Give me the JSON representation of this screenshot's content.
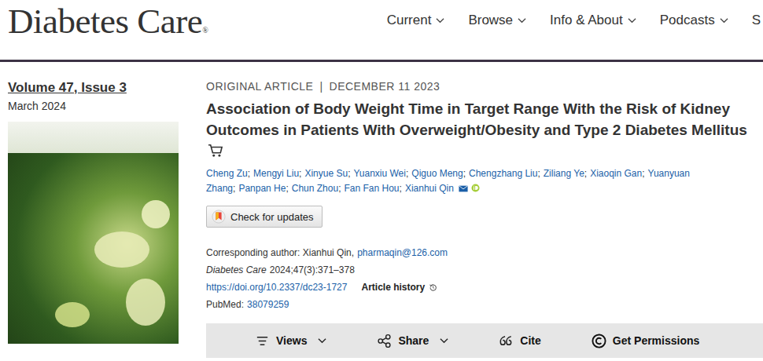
{
  "logo": {
    "text": "Diabetes Care",
    "mark": "®"
  },
  "nav": [
    {
      "label": "Current",
      "has_menu": true
    },
    {
      "label": "Browse",
      "has_menu": true
    },
    {
      "label": "Info & About",
      "has_menu": true
    },
    {
      "label": "Podcasts",
      "has_menu": true
    },
    {
      "label": "S",
      "has_menu": false
    }
  ],
  "issue": {
    "volume": "Volume 47, Issue 3",
    "date": "March 2024"
  },
  "article": {
    "type": "ORIGINAL ARTICLE",
    "separator": "|",
    "date": "DECEMBER 11 2023",
    "title": "Association of Body Weight Time in Target Range With the Risk of Kidney Outcomes in Patients With Overweight/Obesity and Type 2 Diabetes Mellitus",
    "author_separator": ";",
    "authors": [
      "Cheng Zu",
      "Mengyi Liu",
      "Xinyue Su",
      "Yuanxiu Wei",
      "Qiguo Meng",
      "Chengzhang Liu",
      "Ziliang Ye",
      "Xiaoqin Gan",
      "Yuanyuan Zhang",
      "Panpan He",
      "Chun Zhou",
      "Fan Fan Hou",
      "Xianhui Qin"
    ]
  },
  "check_updates": "Check for updates",
  "corresponding": {
    "label": "Corresponding author: Xianhui Qin,",
    "email": "pharmaqin@126.com"
  },
  "citation": {
    "journal": "Diabetes Care",
    "details": "2024;47(3):371–378"
  },
  "doi": "https://doi.org/10.2337/dc23-1727",
  "history": "Article history",
  "pubmed": {
    "label": "PubMed:",
    "id": "38079259"
  },
  "toolbar": [
    {
      "label": "Views",
      "icon": "views",
      "has_menu": true
    },
    {
      "label": "Share",
      "icon": "share",
      "has_menu": true
    },
    {
      "label": "Cite",
      "icon": "cite",
      "has_menu": false
    },
    {
      "label": "Get Permissions",
      "icon": "permissions",
      "has_menu": false
    }
  ]
}
